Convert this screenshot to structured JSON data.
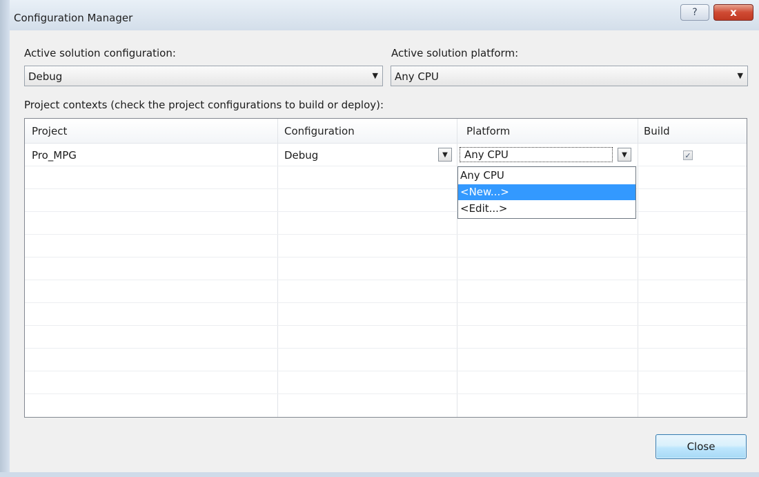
{
  "window": {
    "title": "Configuration Manager",
    "help_glyph": "?",
    "close_glyph": "x"
  },
  "solution": {
    "config_label": "Active solution configuration:",
    "config_value": "Debug",
    "platform_label": "Active solution platform:",
    "platform_value": "Any CPU"
  },
  "contexts_label": "Project contexts (check the project configurations to build or deploy):",
  "grid": {
    "headers": [
      "Project",
      "Configuration",
      "Platform",
      "Build"
    ],
    "rows": [
      {
        "project": "Pro_MPG",
        "configuration": "Debug",
        "platform": "Any CPU",
        "build": true
      }
    ]
  },
  "platform_dropdown": {
    "options": [
      "Any CPU",
      "<New...>",
      "<Edit...>"
    ],
    "selected_index": 1
  },
  "footer": {
    "close_label": "Close"
  },
  "icons": {
    "dropdown_arrow": "▼",
    "check": "✓"
  },
  "colors": {
    "selection": "#3399ff",
    "close_x": "#c9432c"
  }
}
